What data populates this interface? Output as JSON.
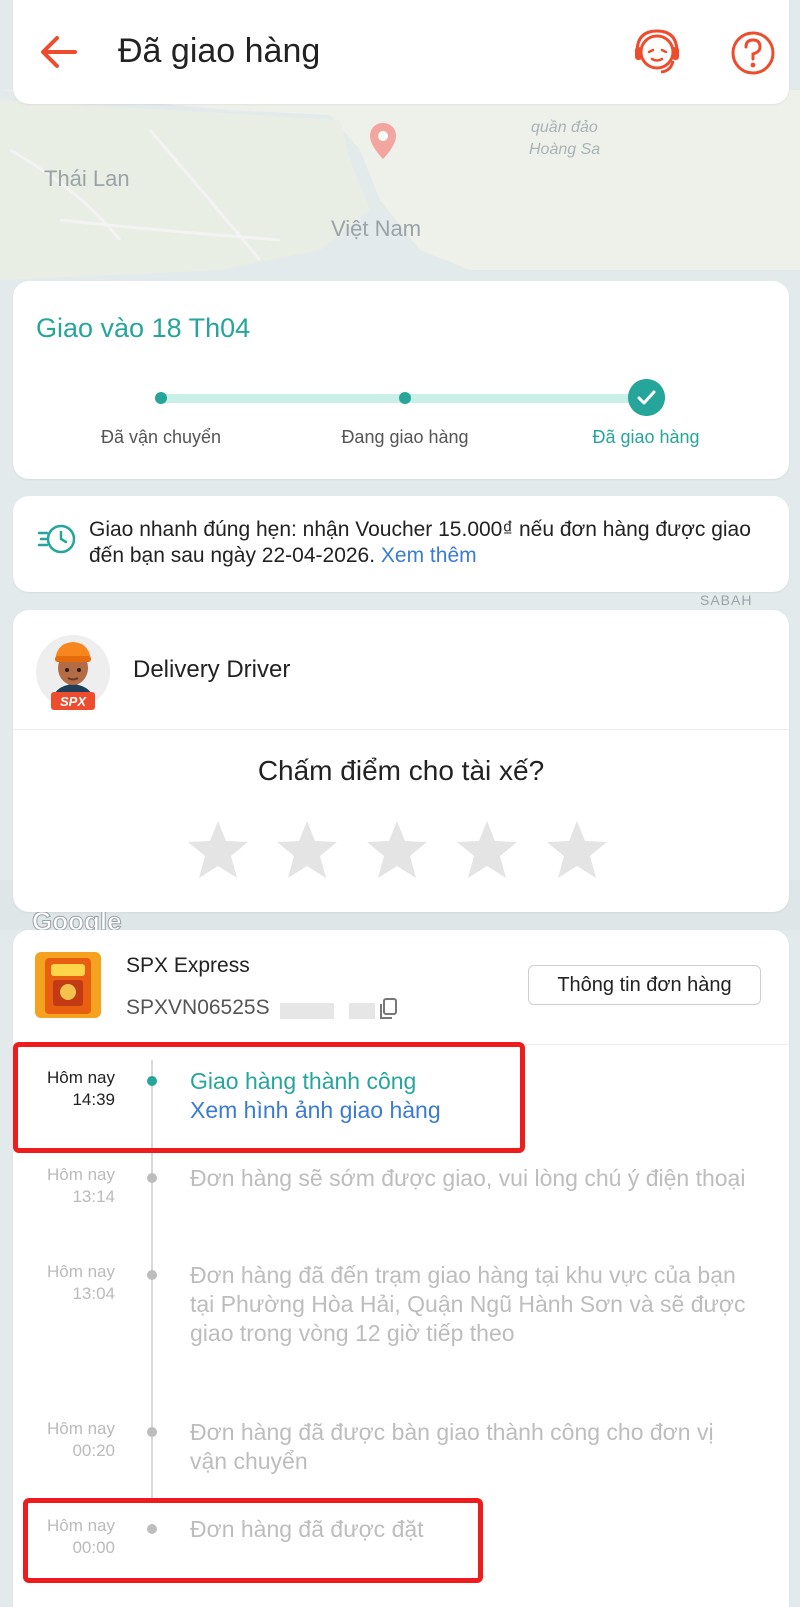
{
  "header": {
    "title": "Đã giao hàng",
    "accent_color": "#ee4d2d"
  },
  "map": {
    "labels": [
      "Thái Lan",
      "Việt Nam",
      "quần đảo",
      "Hoàng Sa",
      "SABAH"
    ],
    "attribution": "Google"
  },
  "status": {
    "delivery_date": "Giao vào 18 Th04",
    "steps": [
      "Đã vận chuyển",
      "Đang giao hàng",
      "Đã giao hàng"
    ],
    "current_step_index": 2,
    "accent_color": "#26a69a"
  },
  "voucher": {
    "text": "Giao nhanh đúng hẹn: nhận Voucher 15.000₫ nếu đơn hàng được giao đến bạn sau ngày 22-04-2026.",
    "link": "Xem thêm"
  },
  "driver": {
    "badge": "SPX",
    "name": "Delivery Driver",
    "rating_question": "Chấm điểm cho tài xế?",
    "rating_value": 0,
    "rating_max": 5
  },
  "shipment": {
    "carrier": "SPX Express",
    "tracking_number": "SPXVN06525S",
    "order_info_button": "Thông tin đơn hàng",
    "events": [
      {
        "date": "Hôm nay",
        "time": "14:39",
        "description": "Giao hàng thành công",
        "link": "Xem hình ảnh giao hàng",
        "active": true
      },
      {
        "date": "Hôm nay",
        "time": "13:14",
        "description": "Đơn hàng sẽ sớm được giao, vui lòng chú ý điện thoại"
      },
      {
        "date": "Hôm nay",
        "time": "13:04",
        "description": "Đơn hàng đã đến trạm giao hàng tại khu vực của bạn tại Phường Hòa Hải, Quận Ngũ Hành Sơn và sẽ được giao trong vòng 12 giờ tiếp theo"
      },
      {
        "date": "Hôm nay",
        "time": "00:20",
        "description": "Đơn hàng đã được bàn giao thành công cho đơn vị vận chuyển"
      },
      {
        "date": "Hôm nay",
        "time": "00:00",
        "description": "Đơn hàng đã được đặt"
      }
    ]
  }
}
